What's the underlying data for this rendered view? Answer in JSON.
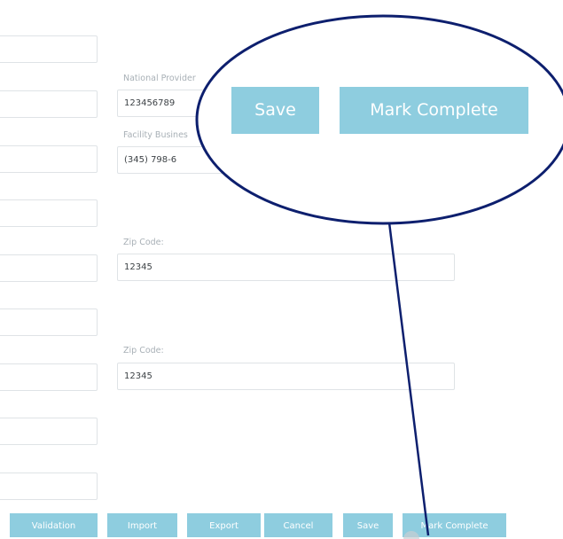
{
  "form": {
    "npi_label": "National Provider",
    "npi_value": "123456789",
    "phone_label": "Facility Busines",
    "phone_value": "(345) 798-6",
    "zip1_label": "Zip Code:",
    "zip1_value": "12345",
    "zip2_label": "Zip Code:",
    "zip2_value": "12345"
  },
  "callout": {
    "save_label": "Save",
    "mark_complete_label": "Mark Complete"
  },
  "toolbar": {
    "validation_label": "Validation",
    "import_label": "Import",
    "export_label": "Export",
    "cancel_label": "Cancel",
    "save_label": "Save",
    "mark_complete_label": "Mark Complete"
  },
  "colors": {
    "button_bg": "#8ecddf",
    "button_text": "#ffffff",
    "annotation_stroke": "#0d1f6e"
  }
}
